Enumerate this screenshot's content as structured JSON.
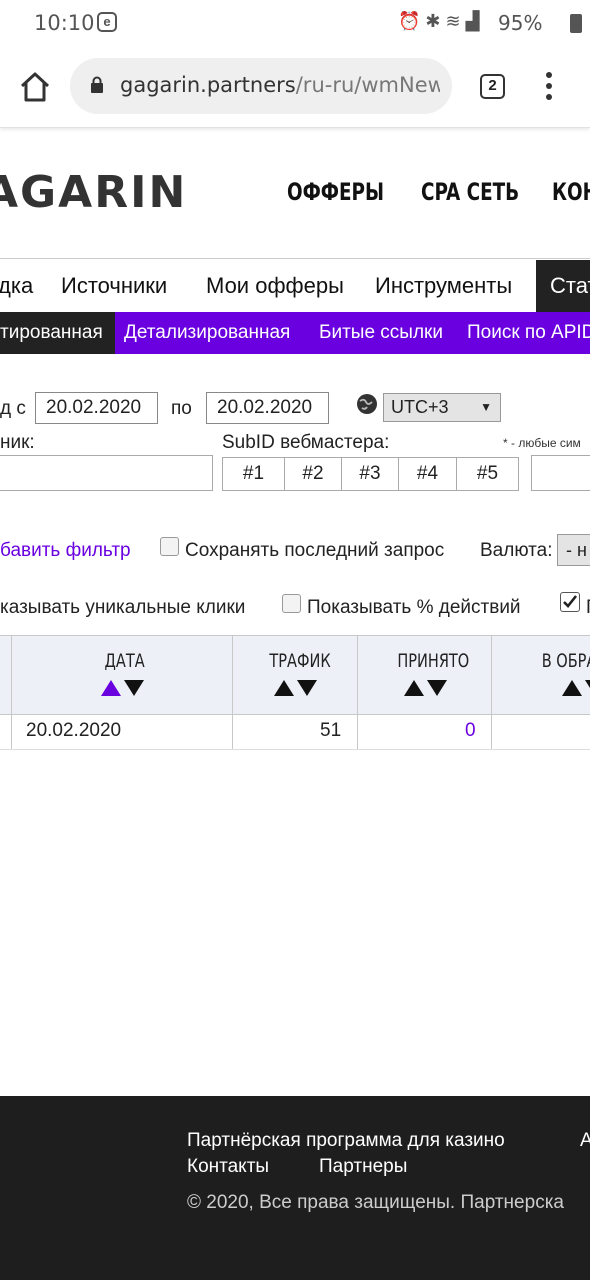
{
  "status_bar": {
    "time": "10:10",
    "battery": "95%"
  },
  "browser": {
    "url_domain": "gagarin.partners",
    "url_path": "/ru-ru/wmNewSta",
    "tab_count": "2"
  },
  "site": {
    "logo": "AGARIN",
    "topnav": [
      "ОФФЕРЫ",
      "CPA СЕТЬ",
      "КОН"
    ]
  },
  "menu1": [
    "дка",
    "Источники",
    "Мои офферы",
    "Инструменты",
    "Стат"
  ],
  "menu2": [
    "тированная",
    "Детализированная",
    "Битые ссылки",
    "Поиск по APID"
  ],
  "filters": {
    "period_label": "д с",
    "date_from": "20.02.2020",
    "to_label": "по",
    "date_to": "20.02.2020",
    "timezone": "UTC+3",
    "source_label": "ник:",
    "subid_label": "SubID вебмастера:",
    "hint": "* - любые сим",
    "subid_buttons": [
      "#1",
      "#2",
      "#3",
      "#4",
      "#5"
    ],
    "add_filter": "бавить фильтр",
    "save_last": "Сохранять последний запрос",
    "currency_label": "Валюта:",
    "currency_value": "- н",
    "show_unique": "казывать уникальные клики",
    "show_percent": "Показывать % действий",
    "last_checkbox_label": "П"
  },
  "table": {
    "headers": [
      "ДАТА",
      "ТРАФИК",
      "ПРИНЯТО",
      "В ОБРАБ"
    ],
    "rows": [
      {
        "date": "20.02.2020",
        "traffic": "51",
        "accepted": "0"
      }
    ]
  },
  "footer": {
    "link1": "Партнёрская программа для казино",
    "link1b": "А",
    "link2": "Контакты",
    "link3": "Партнеры",
    "copyright": "© 2020, Все права защищены. Партнерска"
  },
  "colors": {
    "accent": "#6a00e0",
    "dark": "#222222",
    "footer": "#1e1e1e"
  }
}
